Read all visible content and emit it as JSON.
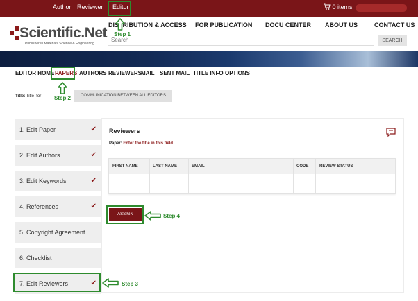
{
  "topbar": {
    "links": [
      "Author",
      "Reviewer",
      "Editor"
    ],
    "cart": "0 items"
  },
  "header": {
    "logo_text": "Scientific.Net",
    "logo_subtitle": "Publisher in Materials Science & Engineering",
    "nav": [
      "DISTRIBUTION & ACCESS",
      "FOR PUBLICATION",
      "DOCU CENTER",
      "ABOUT US",
      "CONTACT US"
    ],
    "search_placeholder": "Search",
    "search_button": "SEARCH"
  },
  "editor_nav": [
    "EDITOR HOME",
    "PAPERS",
    "AUTHORS",
    "REVIEWERS",
    "MAIL",
    "SENT MAIL",
    "TITLE INFO",
    "OPTIONS"
  ],
  "title_row": {
    "label": "Title:",
    "value": "Title_for",
    "communication_button": "COMMUNICATION BETWEEN ALL EDITORS"
  },
  "steps": [
    {
      "label": "1. Edit Paper",
      "checked": true
    },
    {
      "label": "2. Edit Authors",
      "checked": true
    },
    {
      "label": "3. Edit Keywords",
      "checked": true
    },
    {
      "label": "4. References",
      "checked": true
    },
    {
      "label": "5. Copyright Agreement",
      "checked": false
    },
    {
      "label": "6. Checklist",
      "checked": false
    },
    {
      "label": "7. Edit Reviewers",
      "checked": true
    }
  ],
  "reviewers": {
    "title": "Reviewers",
    "paper_label": "Paper:",
    "paper_value": "Enter the title in this field",
    "columns": [
      "FIRST NAME",
      "LAST NAME",
      "EMAIL",
      "CODE",
      "REVIEW STATUS"
    ],
    "assign_button": "ASSIGN"
  },
  "annotations": [
    "Step 1",
    "Step 2",
    "Step 3",
    "Step 4"
  ],
  "icons": {
    "cart": "cart-icon",
    "check": "check-icon",
    "comment": "comment-icon",
    "arrow": "arrow-icon",
    "check_glyph": "✔"
  },
  "colors": {
    "brand": "#7a1518",
    "annotation": "#2e8b2e",
    "check": "#8b1a1a"
  }
}
